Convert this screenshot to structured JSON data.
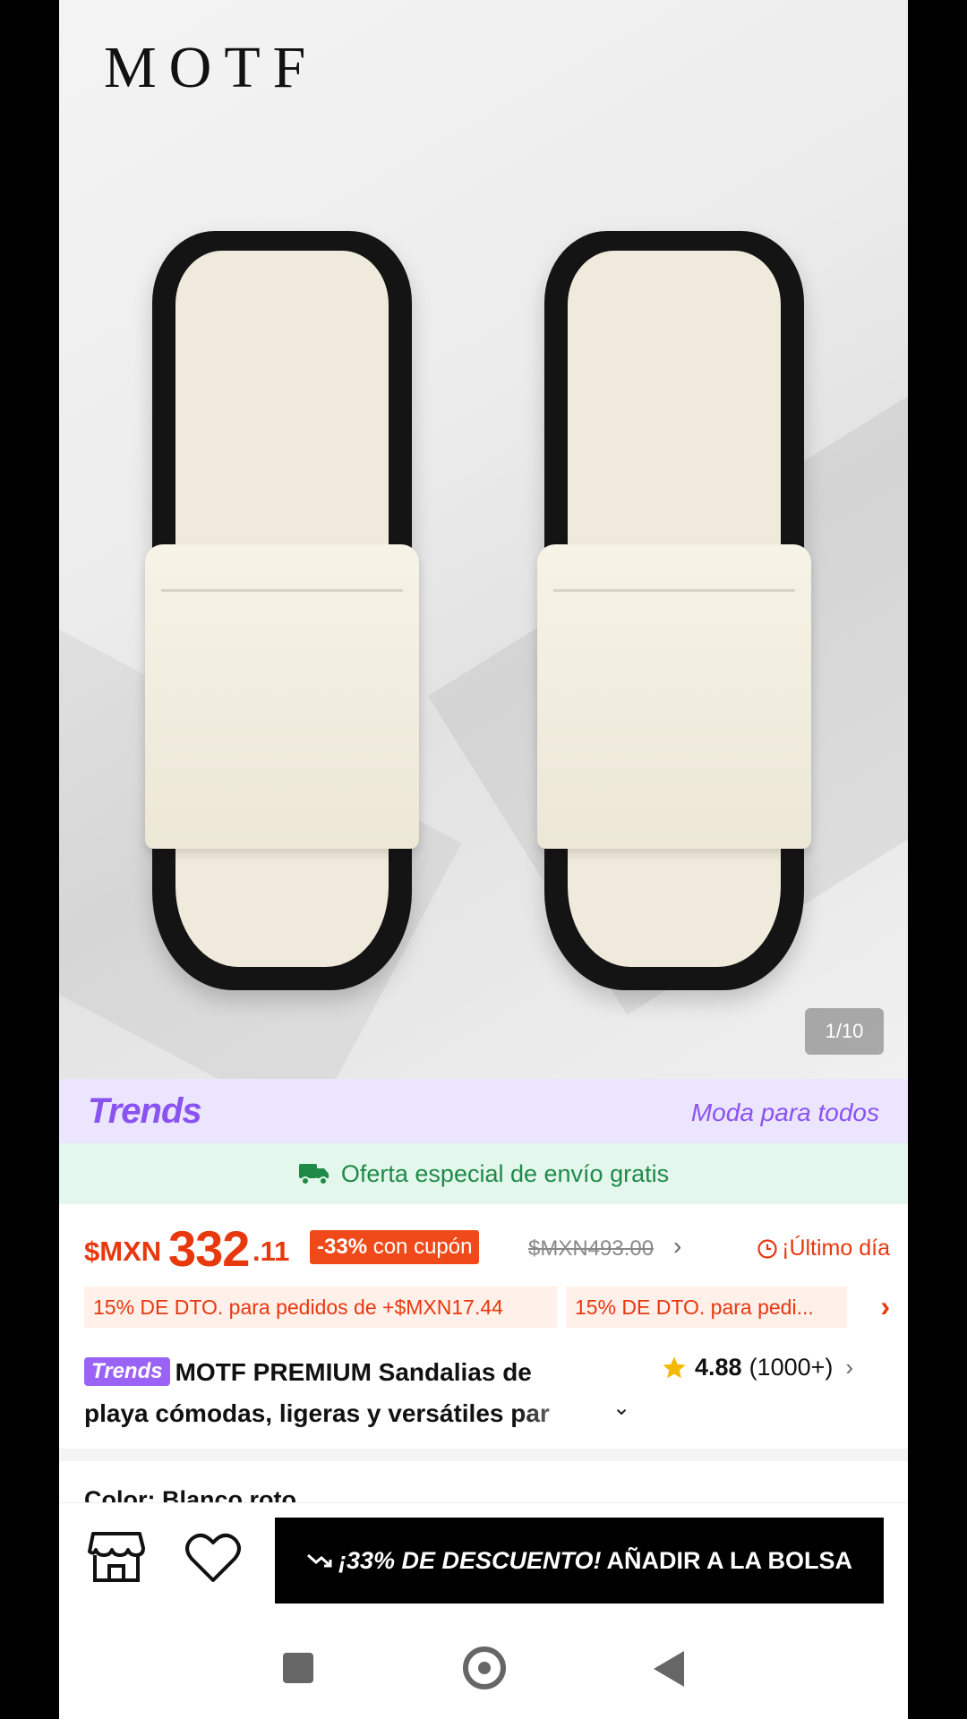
{
  "hero": {
    "brand_logo": "MOTF",
    "photo_counter": "1/10"
  },
  "trends_banner": {
    "logo": "Trends",
    "tagline": "Moda para todos",
    "accent_color": "#8a52f0"
  },
  "shipping": {
    "text": "Oferta especial de envío gratis",
    "icon": "truck-icon",
    "color": "#1e8a48"
  },
  "price": {
    "currency": "$MXN",
    "integer": "332",
    "decimal": ".11",
    "discount_percent": "-33%",
    "discount_suffix": " con cupón",
    "original_price": "$MXN493.00",
    "countdown_label": "¡Último día",
    "color": "#e8380e"
  },
  "promotions": [
    "15% DE DTO. para pedidos de +$MXN17.44",
    "15% DE DTO. para pedi..."
  ],
  "product": {
    "badge": "Trends",
    "title_line1": "MOTF PREMIUM Sandalias de",
    "title_line2": "playa cómodas, ligeras y versátiles par",
    "rating": "4.88",
    "review_count": "(1000+)"
  },
  "variant": {
    "color_label": "Color: Blanco roto"
  },
  "action_bar": {
    "discount_label": "¡33% DE DESCUENTO!",
    "add_label": "AÑADIR A LA BOLSA"
  }
}
